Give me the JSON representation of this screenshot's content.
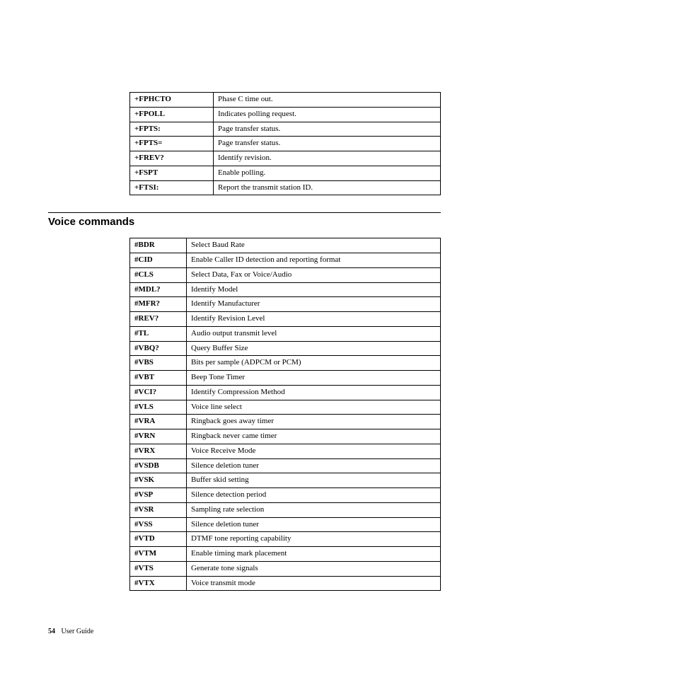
{
  "fax_commands": [
    {
      "code": "+FPHCTO",
      "desc": "Phase C time out."
    },
    {
      "code": "+FPOLL",
      "desc": "Indicates polling request."
    },
    {
      "code": "+FPTS:",
      "desc": "Page transfer status."
    },
    {
      "code": "+FPTS=",
      "desc": "Page transfer status."
    },
    {
      "code": "+FREV?",
      "desc": "Identify revision."
    },
    {
      "code": "+FSPT",
      "desc": "Enable polling."
    },
    {
      "code": "+FTSI:",
      "desc": "Report the transmit station ID."
    }
  ],
  "section_title": "Voice commands",
  "voice_commands": [
    {
      "code": "#BDR",
      "desc": "Select Baud Rate"
    },
    {
      "code": "#CID",
      "desc": "Enable Caller ID detection and reporting format"
    },
    {
      "code": "#CLS",
      "desc": "Select Data, Fax or Voice/Audio"
    },
    {
      "code": "#MDL?",
      "desc": "Identify Model"
    },
    {
      "code": "#MFR?",
      "desc": "Identify Manufacturer"
    },
    {
      "code": "#REV?",
      "desc": "Identify Revision Level"
    },
    {
      "code": "#TL",
      "desc": "Audio output transmit level"
    },
    {
      "code": "#VBQ?",
      "desc": "Query Buffer Size"
    },
    {
      "code": "#VBS",
      "desc": "Bits per sample (ADPCM or PCM)"
    },
    {
      "code": "#VBT",
      "desc": "Beep Tone Timer"
    },
    {
      "code": "#VCI?",
      "desc": "Identify Compression Method"
    },
    {
      "code": "#VLS",
      "desc": "Voice line select"
    },
    {
      "code": "#VRA",
      "desc": "Ringback goes away timer"
    },
    {
      "code": "#VRN",
      "desc": "Ringback never came timer"
    },
    {
      "code": "#VRX",
      "desc": "Voice Receive Mode"
    },
    {
      "code": "#VSDB",
      "desc": "Silence deletion tuner"
    },
    {
      "code": "#VSK",
      "desc": "Buffer skid setting"
    },
    {
      "code": "#VSP",
      "desc": "Silence detection period"
    },
    {
      "code": "#VSR",
      "desc": "Sampling rate selection"
    },
    {
      "code": "#VSS",
      "desc": "Silence deletion tuner"
    },
    {
      "code": "#VTD",
      "desc": "DTMF tone reporting capability"
    },
    {
      "code": "#VTM",
      "desc": "Enable timing mark placement"
    },
    {
      "code": "#VTS",
      "desc": "Generate tone signals"
    },
    {
      "code": "#VTX",
      "desc": "Voice transmit mode"
    }
  ],
  "footer": {
    "page_number": "54",
    "label": "User Guide"
  }
}
